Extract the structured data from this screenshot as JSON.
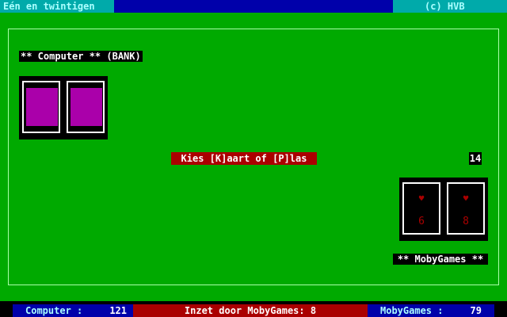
{
  "header": {
    "title": "Eén en twintigen",
    "copyright": "(c) HVB"
  },
  "bank": {
    "label": "** Computer ** (BANK)",
    "card_count": 2
  },
  "player": {
    "label": "** MobyGames **",
    "total": "14",
    "cards": [
      {
        "suit": "heart",
        "symbol": "♥",
        "value": "6"
      },
      {
        "suit": "heart",
        "symbol": "♥",
        "value": "8"
      }
    ]
  },
  "prompt": "Kies [K]aart of [P]las",
  "status": {
    "computer_label": "Computer :",
    "computer_score": "121",
    "bet_text": "Inzet door MobyGames: 8",
    "player_label": "MobyGames :",
    "player_score": "79"
  },
  "colors": {
    "table": "#00aa00",
    "card_back": "#aa00aa",
    "prompt_bg": "#aa0000"
  }
}
